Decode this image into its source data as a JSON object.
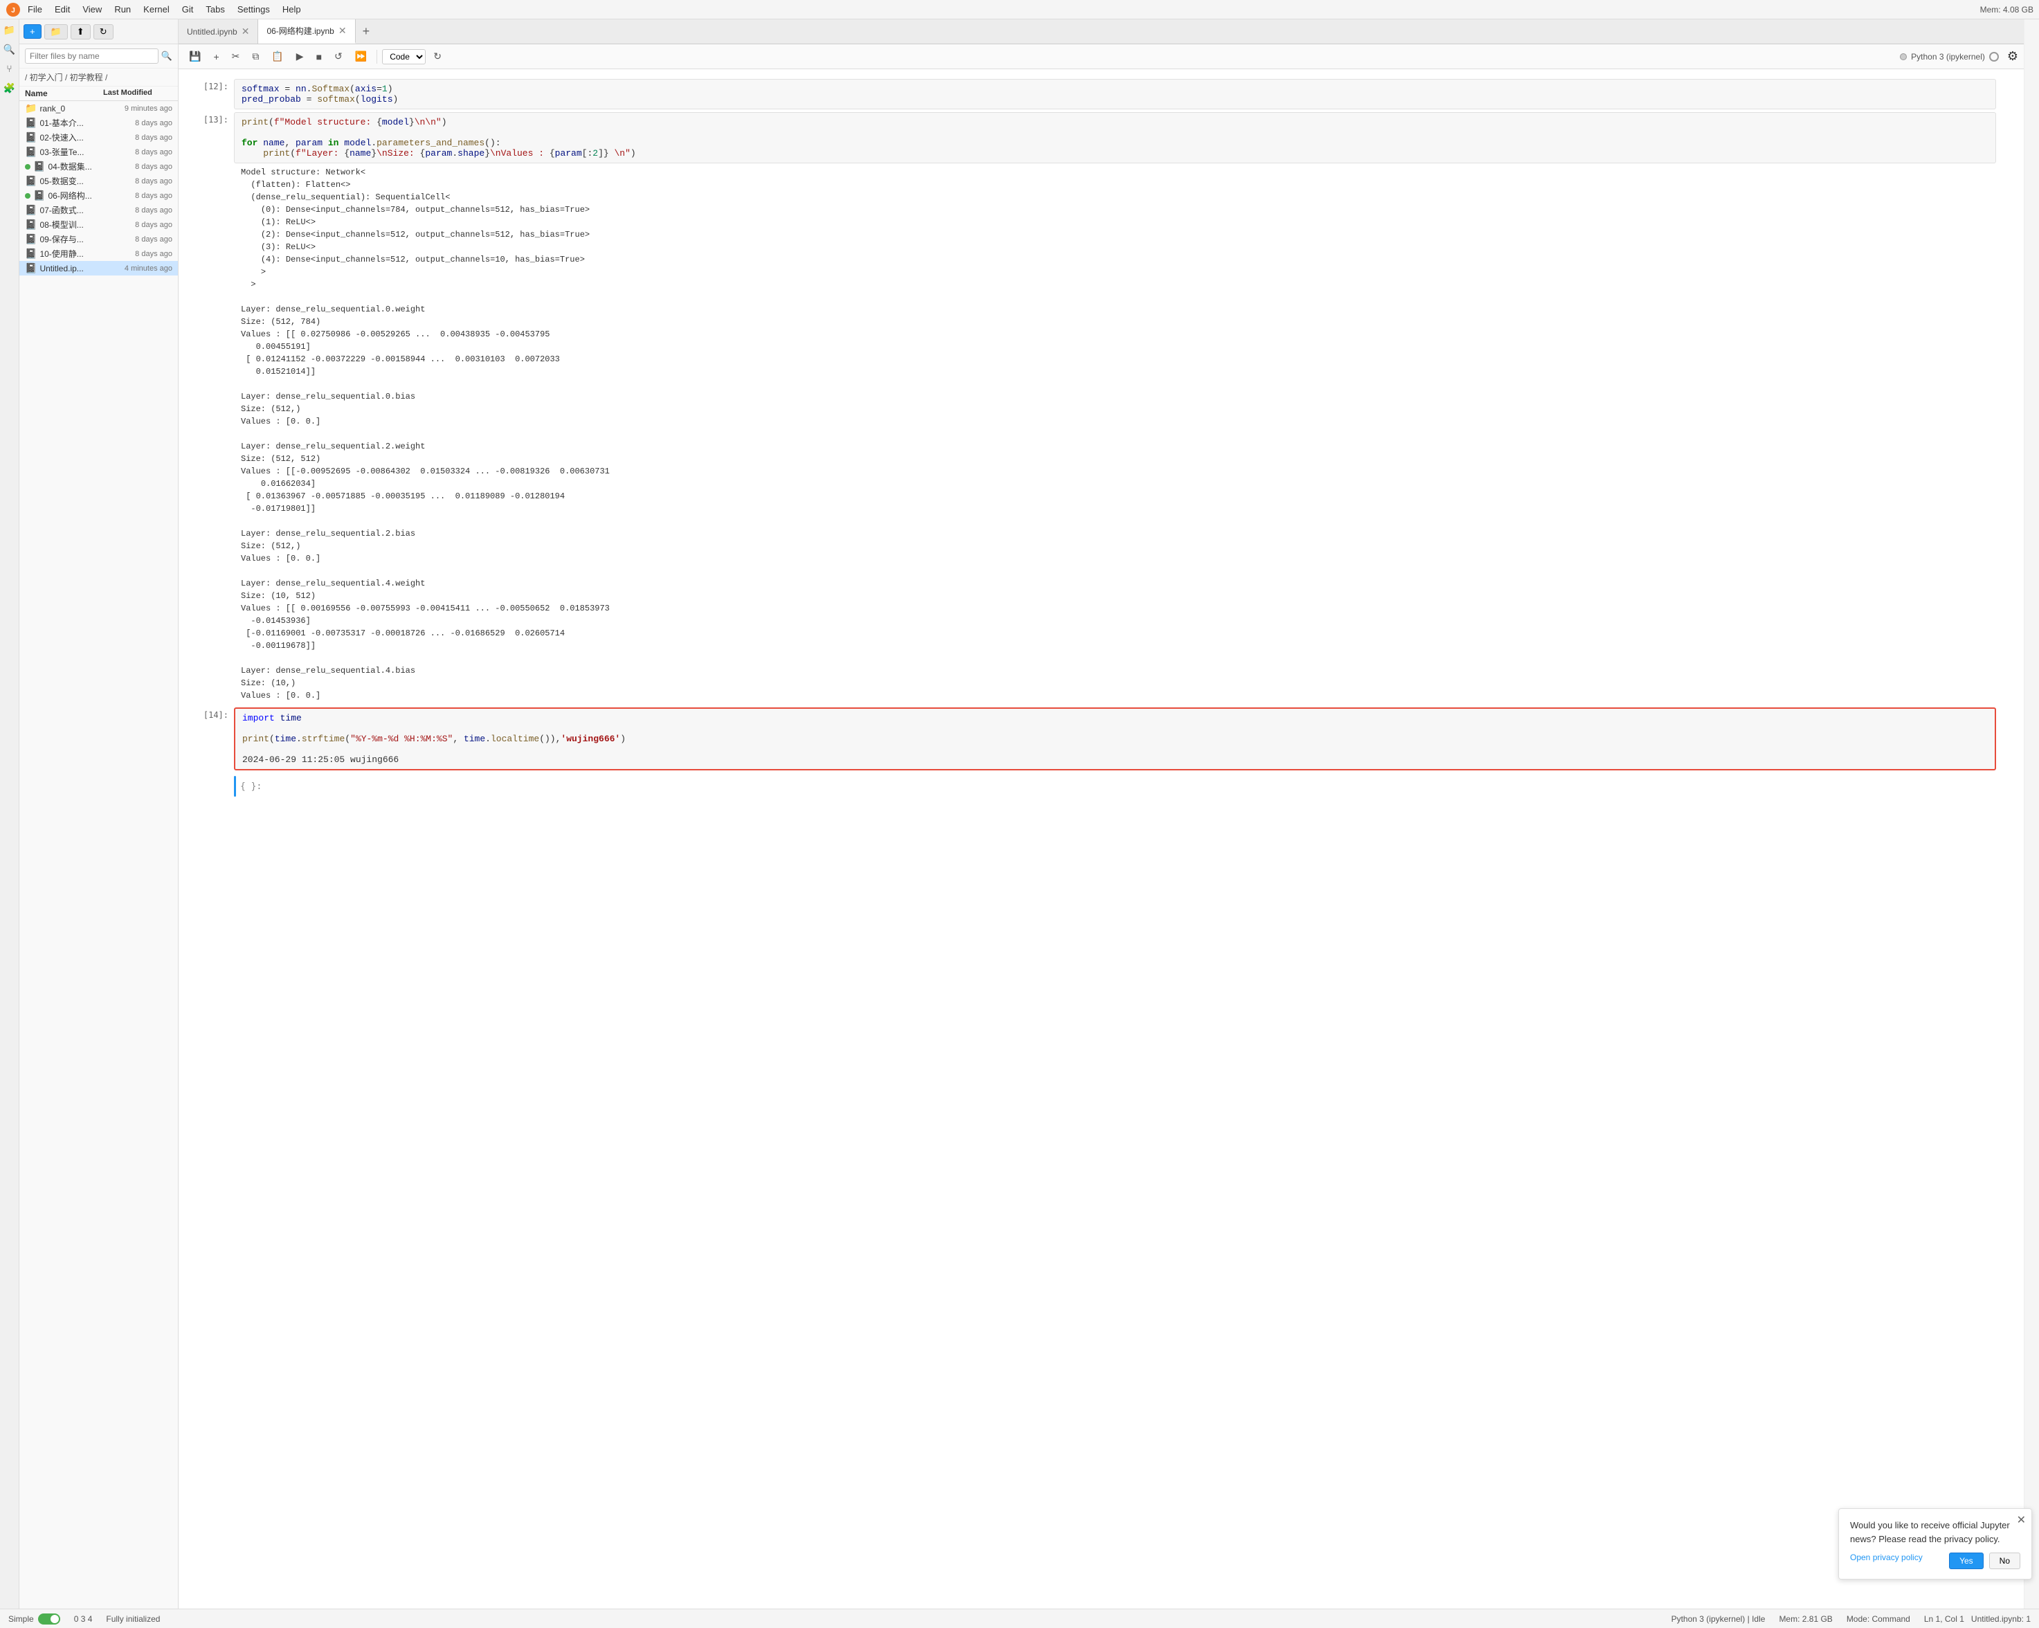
{
  "app": {
    "title": "JupyterLab",
    "mem": "Mem: 4.08 GB"
  },
  "menubar": {
    "items": [
      "File",
      "Edit",
      "View",
      "Run",
      "Kernel",
      "Git",
      "Tabs",
      "Settings",
      "Help"
    ]
  },
  "toolbar": {
    "new_label": "+",
    "open_label": "📁",
    "upload_label": "⬆",
    "refresh_label": "↻"
  },
  "file_browser": {
    "search_placeholder": "Filter files by name",
    "breadcrumb": "/ 初学入门 / 初学教程 /",
    "col_name": "Name",
    "col_date": "Last Modified",
    "files": [
      {
        "name": "rank_0",
        "date": "9 minutes ago",
        "type": "folder",
        "icon": "📁",
        "dot": ""
      },
      {
        "name": "01-基本介...",
        "date": "8 days ago",
        "type": "notebook",
        "icon": "📓",
        "dot": ""
      },
      {
        "name": "02-快速入...",
        "date": "8 days ago",
        "type": "notebook",
        "icon": "📓",
        "dot": ""
      },
      {
        "name": "03-张量Te...",
        "date": "8 days ago",
        "type": "notebook",
        "icon": "📓",
        "dot": ""
      },
      {
        "name": "04-数据集...",
        "date": "8 days ago",
        "type": "notebook",
        "icon": "📓",
        "dot": "green"
      },
      {
        "name": "05-数据变...",
        "date": "8 days ago",
        "type": "notebook",
        "icon": "📓",
        "dot": ""
      },
      {
        "name": "06-网络构...",
        "date": "8 days ago",
        "type": "notebook",
        "icon": "📓",
        "dot": "green"
      },
      {
        "name": "07-函数式...",
        "date": "8 days ago",
        "type": "notebook",
        "icon": "📓",
        "dot": ""
      },
      {
        "name": "08-模型训...",
        "date": "8 days ago",
        "type": "notebook",
        "icon": "📓",
        "dot": ""
      },
      {
        "name": "09-保存与...",
        "date": "8 days ago",
        "type": "notebook",
        "icon": "📓",
        "dot": ""
      },
      {
        "name": "10-使用静...",
        "date": "8 days ago",
        "type": "notebook",
        "icon": "📓",
        "dot": ""
      },
      {
        "name": "Untitled.ip...",
        "date": "4 minutes ago",
        "type": "notebook",
        "icon": "📓",
        "dot": "",
        "selected": true
      }
    ]
  },
  "tabs": [
    {
      "id": "tab1",
      "label": "Untitled.ipynb",
      "active": false,
      "closable": true
    },
    {
      "id": "tab2",
      "label": "06-网络构建.ipynb",
      "active": true,
      "closable": true
    }
  ],
  "nb_toolbar": {
    "save": "💾",
    "add": "+",
    "cut": "✂",
    "copy": "⧉",
    "paste": "📋",
    "run": "▶",
    "stop": "■",
    "restart": "↺",
    "fast_forward": "⏩",
    "cell_type": "Code",
    "refresh": "↻",
    "kernel_name": "Python 3 (ipykernel)",
    "kernel_status": "idle"
  },
  "cells": [
    {
      "id": "c12",
      "label": "[12]:",
      "type": "input",
      "active": false
    },
    {
      "id": "c13",
      "label": "[13]:",
      "type": "input",
      "active": false
    },
    {
      "id": "c14",
      "label": "[14]:",
      "type": "input",
      "active": true
    }
  ],
  "code": {
    "c12_line1": "softmax = nn.Softmax(axis=1)",
    "c12_line2": "pred_probab = softmax(logits)",
    "c13_input": "print(f\"Model structure: {model}\\n\\n\")",
    "c13_for": "for name, param in model.parameters_and_names():",
    "c13_print": "    print(f\"Layer: {name}\\nSize: {param.shape}\\nValues : {param[:2]} \\n\")",
    "c13_output": "Model structure: Network<\n  (flatten): Flatten<>\n  (dense_relu_sequential): SequentialCell<\n    (0): Dense<input_channels=784, output_channels=512, has_bias=True>\n    (1): ReLU<>\n    (2): Dense<input_channels=512, output_channels=512, has_bias=True>\n    (3): ReLU<>\n    (4): Dense<input_channels=512, output_channels=10, has_bias=True>\n    >\n  >\n\nLayer: dense_relu_sequential.0.weight\nSize: (512, 784)\nValues : [[ 0.02750986 -0.00529265 ...  0.00438935 -0.00453795\n     0.00455191]\n [ 0.01241152 -0.00372229 -0.00158944 ...  0.00310103  0.0072033\n   0.01521014]]\n\nLayer: dense_relu_sequential.0.bias\nSize: (512,)\nValues : [0. 0.]\n\nLayer: dense_relu_sequential.2.weight\nSize: (512, 512)\nValues : [[-0.00952695 -0.00864302  0.01503324 ... -0.00819326  0.00630731\n    0.01662034]\n [ 0.01363967 -0.00571885 -0.00035195 ...  0.01189089 -0.01280194\n  -0.01719801]]\n\nLayer: dense_relu_sequential.2.bias\nSize: (512,)\nValues : [0. 0.]\n\nLayer: dense_relu_sequential.4.weight\nSize: (10, 512)\nValues : [[ 0.00169556 -0.00755993 -0.00415411 ... -0.00550652  0.01853973\n  -0.01453936]\n [-0.01169001 -0.00735317 -0.00018726 ... -0.01686529  0.02605714\n  -0.00119678]]\n\nLayer: dense_relu_sequential.4.bias\nSize: (10,)\nValues : [0. 0.]",
    "c14_line1": "import time",
    "c14_line2": "print(time.strftime(\"%Y-%m-%d %H:%M:%S\", time.localtime()),'wujing666')",
    "c14_output": "2024-06-29 11:25:05 wujing666",
    "c14_last": "{ }:"
  },
  "notification": {
    "text": "Would you like to receive official Jupyter news? Please read the privacy policy.",
    "link": "Open privacy policy",
    "yes": "Yes",
    "no": "No"
  },
  "statusbar": {
    "mode": "Simple",
    "cell_info": "0  3  4",
    "status": "Fully initialized",
    "kernel": "Python 3 (ipykernel) | Idle",
    "mem": "Mem: 2.81 GB",
    "mode_label": "Mode: Command",
    "cursor": "Ln 1, Col 1",
    "file": "Untitled.ipynb:",
    "line_num": "1"
  }
}
